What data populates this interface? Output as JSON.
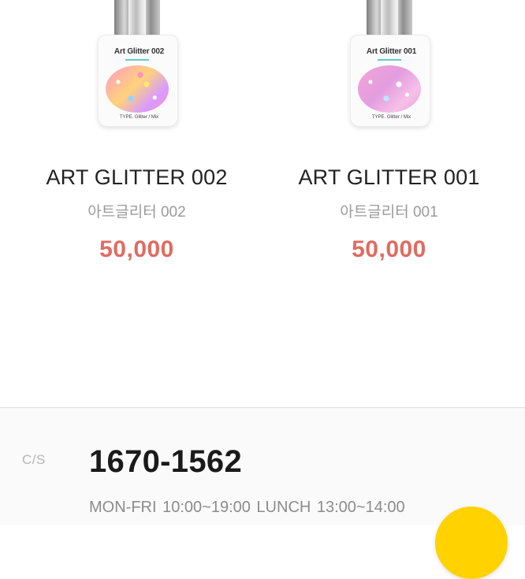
{
  "products": [
    {
      "bottle_label": "Art Glitter 002",
      "bottle_type": "TYPE. Glitter / Mix",
      "name": "ART GLITTER 002",
      "subname": "아트글리터 002",
      "price": "50,000"
    },
    {
      "bottle_label": "Art Glitter 001",
      "bottle_type": "TYPE. Glitter / Mix",
      "name": "ART GLITTER 001",
      "subname": "아트글리터 001",
      "price": "50,000"
    }
  ],
  "footer": {
    "cs_label": "C/S",
    "cs_phone": "1670-1562",
    "cs_hours": "MON-FRI 10:00~19:00  LUNCH 13:00~14:00"
  },
  "colors": {
    "price": "#e06b61",
    "chat_button": "#ffd200"
  },
  "icons": {
    "chat_button": "chat-icon"
  }
}
